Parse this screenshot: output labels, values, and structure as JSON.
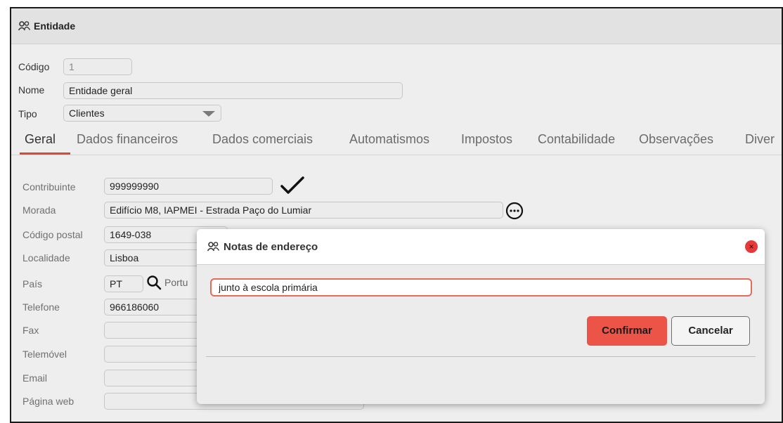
{
  "window": {
    "title": "Entidade"
  },
  "header_fields": {
    "codigo": {
      "label": "Código",
      "value": "1"
    },
    "nome": {
      "label": "Nome",
      "value": "Entidade geral"
    },
    "tipo": {
      "label": "Tipo",
      "value": "Clientes"
    }
  },
  "tabs": [
    {
      "label": "Geral",
      "active": true
    },
    {
      "label": "Dados financeiros"
    },
    {
      "label": "Dados comerciais"
    },
    {
      "label": "Automatismos"
    },
    {
      "label": "Impostos"
    },
    {
      "label": "Contabilidade"
    },
    {
      "label": "Observações"
    },
    {
      "label": "Diver"
    }
  ],
  "form": {
    "contribuinte": {
      "label": "Contribuinte",
      "value": "999999990"
    },
    "morada": {
      "label": "Morada",
      "value": "Edifício M8, IAPMEI - Estrada Paço do Lumiar"
    },
    "codigo_postal": {
      "label": "Código postal",
      "value": "1649-038"
    },
    "localidade": {
      "label": "Localidade",
      "value": "Lisboa"
    },
    "pais": {
      "label": "País",
      "code": "PT",
      "name_partial": "Portu"
    },
    "telefone": {
      "label": "Telefone",
      "value": "966186060"
    },
    "fax": {
      "label": "Fax",
      "value": ""
    },
    "telemovel": {
      "label": "Telemóvel",
      "value": ""
    },
    "email": {
      "label": "Email",
      "value": ""
    },
    "pagina_web": {
      "label": "Página web",
      "value": ""
    }
  },
  "modal": {
    "title": "Notas de endereço",
    "close_label": "×",
    "notes_value": "junto à escola primária",
    "confirm_label": "Confirmar",
    "cancel_label": "Cancelar"
  },
  "colors": {
    "accent": "#ec5447",
    "tab_underline": "#d84a36",
    "close": "#e53a3a"
  },
  "icons": [
    "users-icon",
    "check-icon",
    "more-options-icon",
    "search-icon",
    "close-icon"
  ]
}
